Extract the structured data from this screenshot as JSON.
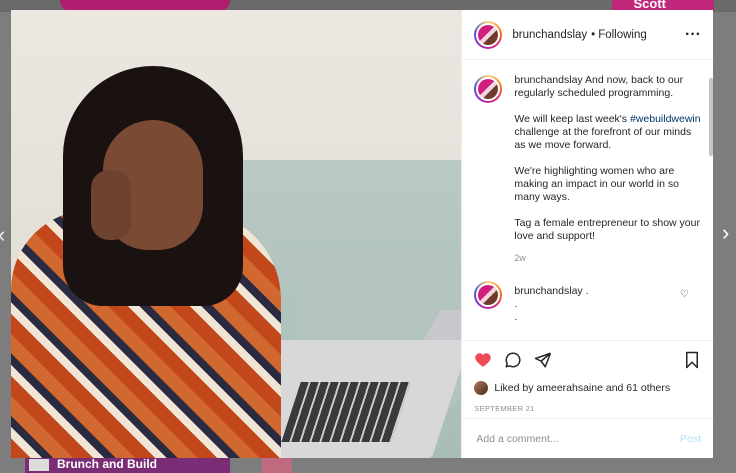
{
  "background": {
    "top_right_text": "Scott",
    "bottom_left_text": "Brunch and Build"
  },
  "post": {
    "header": {
      "username": "brunchandslay",
      "separator": "•",
      "follow_status": "Following",
      "more_icon": "ellipsis-icon"
    },
    "caption": {
      "username": "brunchandslay",
      "p1": "And now, back to our regularly scheduled programming.",
      "p2_before": "We will keep last week's ",
      "hashtag": "#webuildwewin",
      "p2_after": " challenge at the forefront of our minds as we move forward.",
      "p3": "We're highlighting women who are making an impact in our world in so many ways.",
      "p4": "Tag a female entrepreneur to show your love and support!",
      "time": "2w"
    },
    "reply": {
      "username": "brunchandslay",
      "text": ".",
      "line2": ".",
      "line3": "."
    },
    "likes": {
      "prefix": "Liked by",
      "user": "ameerahsaine",
      "suffix": "and 61 others"
    },
    "date": "SEPTEMBER 21",
    "add_comment": {
      "placeholder": "Add a comment...",
      "post_label": "Post"
    },
    "colors": {
      "heart": "#ed4956",
      "hashtag": "#00376b",
      "post_disabled": "#b2dffc"
    }
  }
}
